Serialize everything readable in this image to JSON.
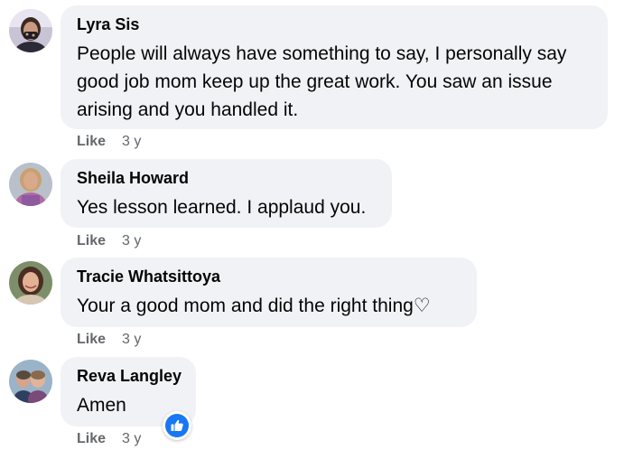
{
  "comments": [
    {
      "author": "Lyra Sis",
      "text": "People will always have something to say, I personally say good job mom keep up the great work. You saw an issue arising and you handled it.",
      "like_label": "Like",
      "time": "3 y",
      "avatar_icon": "profile-photo-masked-person"
    },
    {
      "author": "Sheila Howard",
      "text": "Yes lesson learned. I applaud you.",
      "like_label": "Like",
      "time": "3 y",
      "avatar_icon": "profile-photo-woman"
    },
    {
      "author": "Tracie Whatsittoya",
      "text": "Your a good mom and did the right thing♡",
      "like_label": "Like",
      "time": "3 y",
      "avatar_icon": "profile-photo-woman-dark-hair"
    },
    {
      "author": "Reva Langley",
      "text": "Amen",
      "like_label": "Like",
      "time": "3 y",
      "avatar_icon": "profile-photo-couple"
    }
  ],
  "reaction": {
    "icon": "thumbs-up-icon",
    "color": "#1877f2"
  },
  "colors": {
    "bubble": "#f0f2f5",
    "meta_text": "#65676b",
    "body_text": "#050505"
  }
}
